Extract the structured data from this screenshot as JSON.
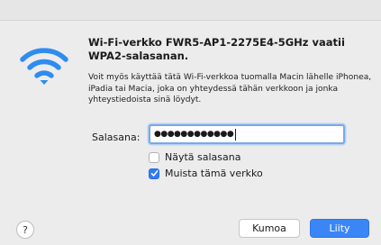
{
  "dialog": {
    "heading": "Wi-Fi-verkko FWR5-AP1-2275E4-5GHz vaatii WPA2-salasanan.",
    "description": "Voit myös käyttää tätä Wi-Fi-verkkoa tuomalla Macin lähelle iPhonea, iPadia tai Macia, joka on yhteydessä tähän verkkoon ja jonka yhteystiedoista sinä löydyt.",
    "icon": "wifi-icon",
    "accent_color": "#2f8cf0"
  },
  "password": {
    "label": "Salasana:",
    "value": "●●●●●●●●●●●●"
  },
  "options": {
    "show_password": {
      "label": "Näytä salasana",
      "checked": false
    },
    "remember_network": {
      "label": "Muista tämä verkko",
      "checked": true
    }
  },
  "buttons": {
    "help": "?",
    "cancel": "Kumoa",
    "join": "Liity",
    "join_color": "#3b86f7"
  }
}
